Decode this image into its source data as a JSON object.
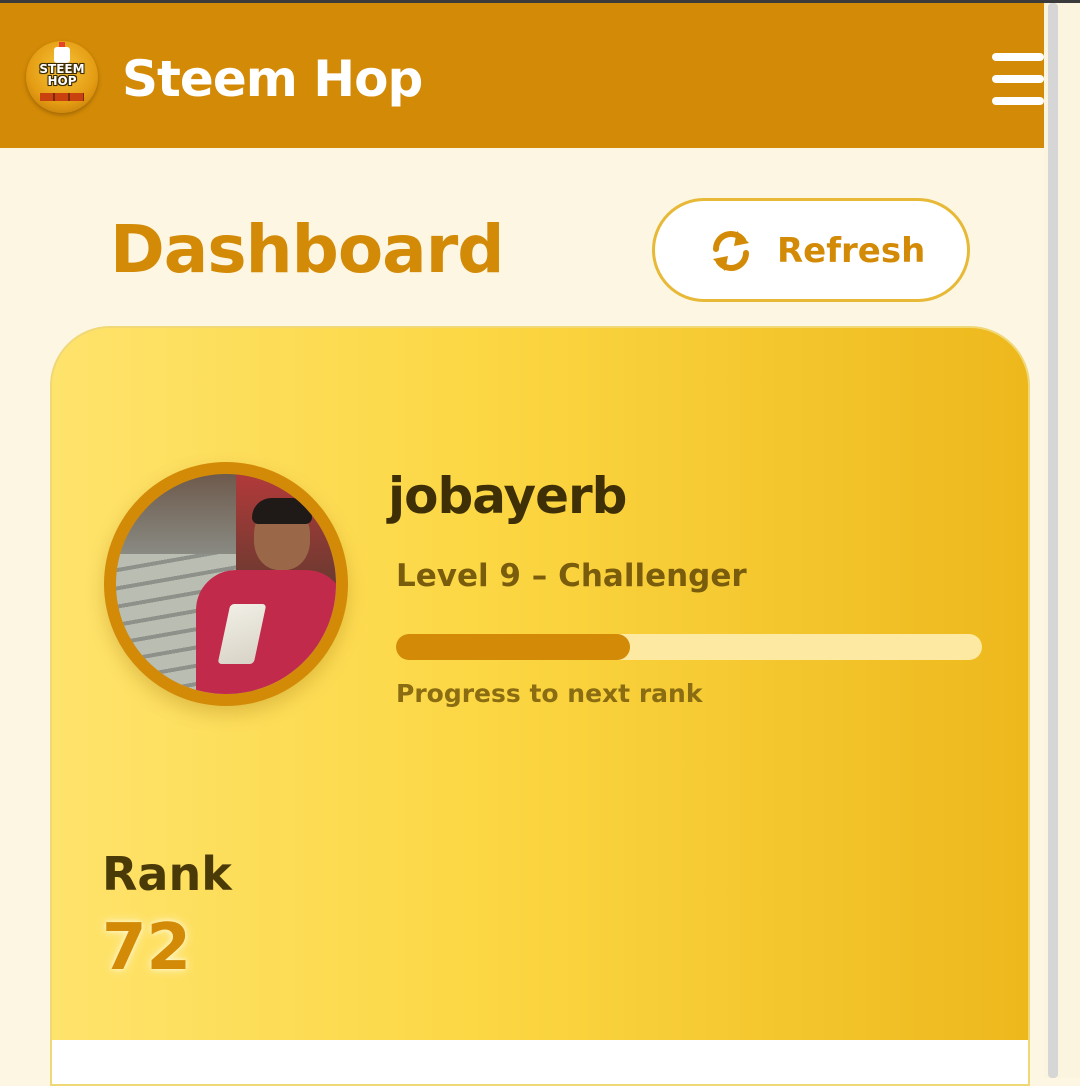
{
  "header": {
    "logo_text": "STEEM HOP",
    "app_title": "Steem Hop",
    "menu_icon": "hamburger-menu-icon"
  },
  "dashboard": {
    "title": "Dashboard",
    "refresh_label": "Refresh",
    "refresh_icon": "refresh-icon"
  },
  "profile": {
    "username": "jobayerb",
    "level_text": "Level 9 – Challenger",
    "progress_fraction": 0.4,
    "progress_caption": "Progress to next rank",
    "rank_label": "Rank",
    "rank_value": "72"
  },
  "colors": {
    "header_bg": "#d38a06",
    "accent": "#d38a06",
    "card_gradient_start": "#fee36c",
    "card_gradient_end": "#edb81c",
    "progress_track": "#fde9a2",
    "page_bg": "#fdf6e3"
  }
}
